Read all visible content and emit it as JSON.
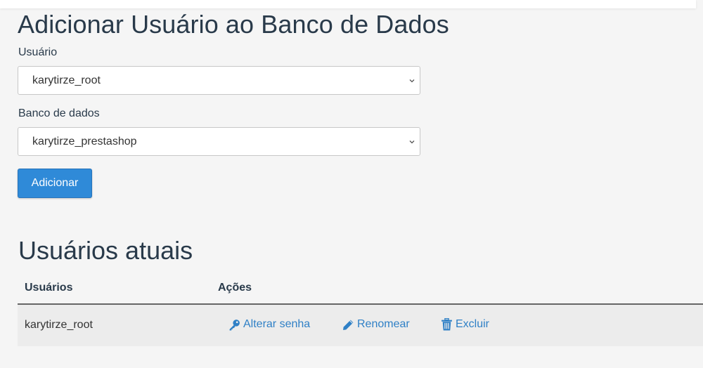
{
  "page_title": "Adicionar Usuário ao Banco de Dados",
  "form": {
    "user_label": "Usuário",
    "user_value": "karytirze_root",
    "db_label": "Banco de dados",
    "db_value": "karytirze_prestashop",
    "add_button": "Adicionar"
  },
  "current_users": {
    "title": "Usuários atuais",
    "columns": [
      "Usuários",
      "Ações"
    ],
    "rows": [
      {
        "user": "karytirze_root",
        "actions": {
          "change_password": "Alterar senha",
          "rename": "Renomear",
          "delete": "Excluir"
        }
      }
    ]
  },
  "icons": {
    "select_arrow": "chevron-down-icon",
    "change_password": "key-icon",
    "rename": "pencil-icon",
    "delete": "trash-icon"
  },
  "colors": {
    "background": "#f5f5f5",
    "primary_button": "#2f8ad8",
    "link": "#2f80c6",
    "text": "#293a4a",
    "row_background": "#ececec"
  }
}
